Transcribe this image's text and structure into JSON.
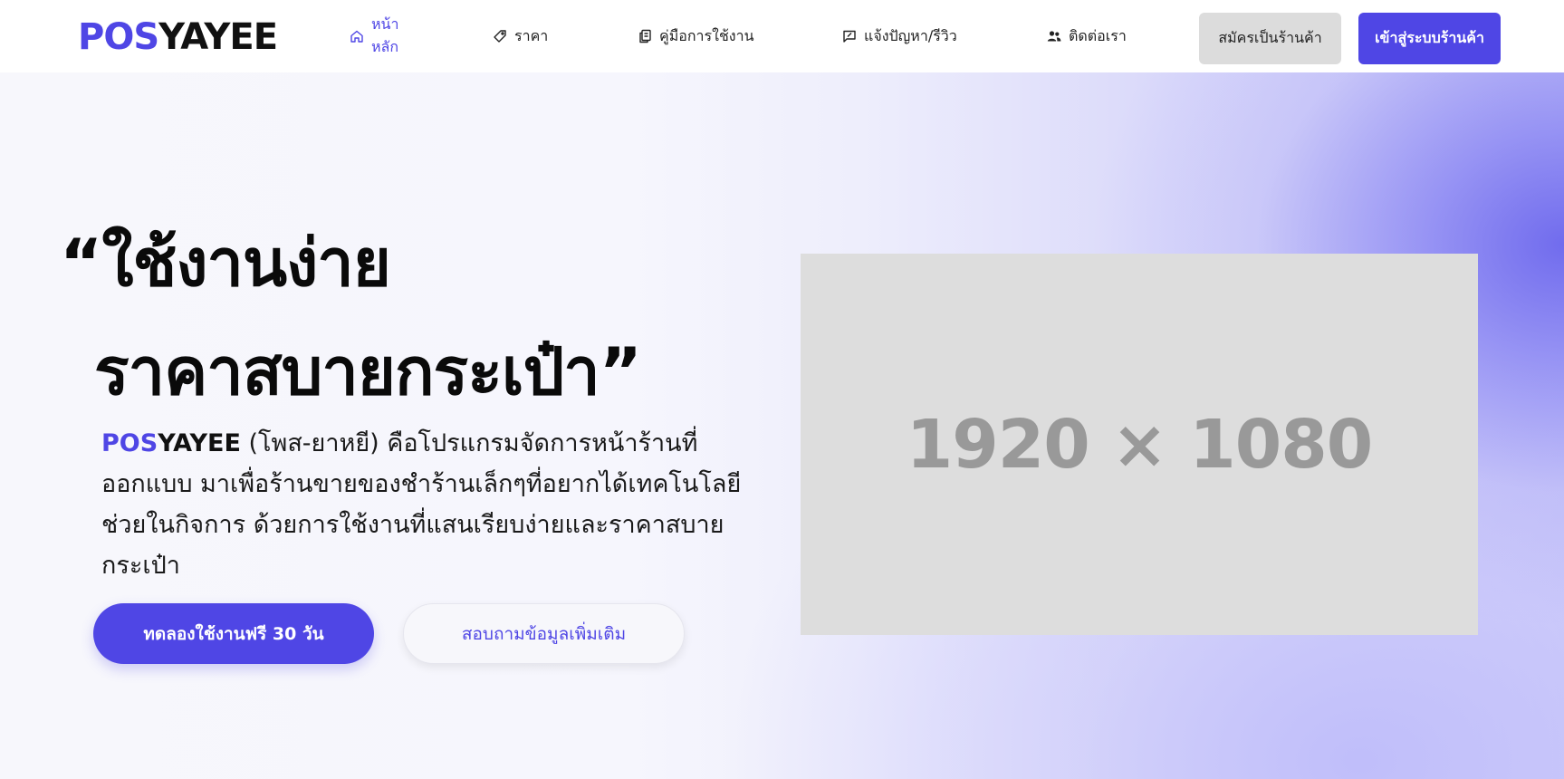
{
  "header": {
    "logo": {
      "part1": "POS",
      "part2": "YAYEE"
    },
    "nav": [
      {
        "label": "หน้าหลัก",
        "icon": "home-icon",
        "active": true
      },
      {
        "label": "ราคา",
        "icon": "tag-icon",
        "active": false
      },
      {
        "label": "คู่มือการใช้งาน",
        "icon": "documents-icon",
        "active": false
      },
      {
        "label": "แจ้งปัญหา/รีวิว",
        "icon": "feedback-icon",
        "active": false
      },
      {
        "label": "ติดต่อเรา",
        "icon": "contacts-icon",
        "active": false
      }
    ],
    "register_label": "สมัครเป็นร้านค้า",
    "login_label": "เข้าสู่ระบบร้านค้า"
  },
  "hero": {
    "headline_line1": "“ใช้งานง่าย",
    "headline_line2": "ราคาสบายกระเป๋า”",
    "brand_part1": "POS",
    "brand_part2": "YAYEE",
    "description": " (โพส-ยาหยี) คือโปรแกรมจัดการหน้าร้านที่ออกแบบ มาเพื่อร้านขายของชำร้านเล็กๆที่อยากได้เทคโนโลยีช่วยในกิจการ ด้วยการใช้งานที่แสนเรียบง่ายและราคาสบายกระเป๋า",
    "trial_label": "ทดลองใช้งานฟรี 30 วัน",
    "inquire_label": "สอบถามข้อมูลเพิ่มเติม",
    "image_placeholder": "1920 × 1080"
  },
  "colors": {
    "accent": "#4f46e5",
    "secondary_button": "#dcdcdc",
    "placeholder_bg": "#dddddd",
    "placeholder_text": "#999999"
  }
}
